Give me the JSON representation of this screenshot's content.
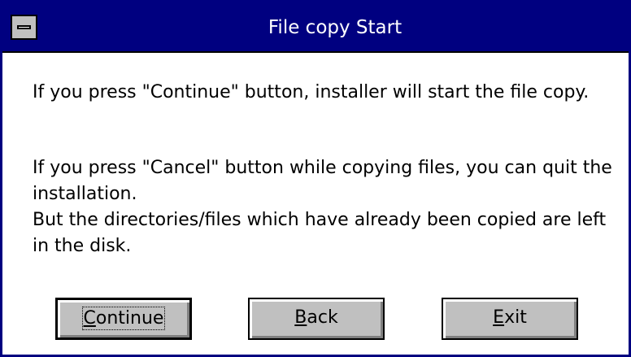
{
  "window": {
    "title": "File copy Start"
  },
  "message": {
    "paragraph1": "If you press \"Continue\" button, installer will start the file copy.",
    "paragraph2_line1": "If you press \"Cancel\" button while copying files, you can quit the installation.",
    "paragraph2_line2": "But the directories/files which have already been copied are left in the disk."
  },
  "buttons": {
    "continue": {
      "mnemonic": "C",
      "rest": "ontinue"
    },
    "back": {
      "mnemonic": "B",
      "rest": "ack"
    },
    "exit": {
      "mnemonic": "E",
      "rest": "xit"
    }
  },
  "colors": {
    "titlebar": "#000080",
    "button_face": "#c0c0c0"
  }
}
